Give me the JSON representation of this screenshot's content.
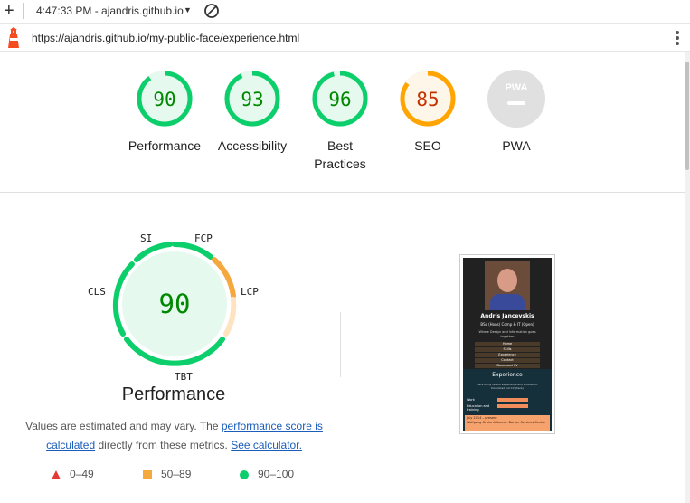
{
  "browser": {
    "time_label": "4:47:33 PM - ajandris.github.io",
    "url": "https://ajandris.github.io/my-public-face/experience.html"
  },
  "summary": [
    {
      "label": "Performance",
      "score": "90",
      "score_value": 90,
      "color": "#0cce6b",
      "text_color": "#008800",
      "fill": "#e6f9ef"
    },
    {
      "label": "Accessibility",
      "score": "93",
      "score_value": 93,
      "color": "#0cce6b",
      "text_color": "#008800",
      "fill": "#e6f9ef"
    },
    {
      "label": "Best Practices",
      "score": "96",
      "score_value": 96,
      "color": "#0cce6b",
      "text_color": "#008800",
      "fill": "#e6f9ef"
    },
    {
      "label": "SEO",
      "score": "85",
      "score_value": 85,
      "color": "#ffa400",
      "text_color": "#c33300",
      "fill": "#fff6ea"
    },
    {
      "label": "PWA",
      "badge": "PWA",
      "color": "#e0e0e0"
    }
  ],
  "performance": {
    "score": "90",
    "title": "Performance",
    "metrics": [
      "SI",
      "FCP",
      "LCP",
      "TBT",
      "CLS"
    ],
    "note_prefix": "Values are estimated and may vary. The ",
    "note_link1": "performance score is calculated",
    "note_middle": " directly from these metrics. ",
    "note_link2": "See calculator."
  },
  "legend": [
    {
      "icon": "triangle-icon",
      "range": "0–49",
      "color": "#e53935"
    },
    {
      "icon": "square-icon",
      "range": "50–89",
      "color": "#f4a83d"
    },
    {
      "icon": "circle-icon",
      "range": "90–100",
      "color": "#0cce6b"
    }
  ],
  "screenshot": {
    "name": "Andris Jancevskis",
    "subtitle": "BSc (Hons) Comp & IT (Open)",
    "tagline": "Where Design and Information goes together",
    "nav": [
      "Home",
      "Skills",
      "Experience",
      "Contact",
      "Download CV"
    ],
    "section_title": "Experience",
    "section_text": "Here is my recent experience and education. Download full CV (here)",
    "filters": [
      "Work",
      "Education and training"
    ],
    "job_dates": "July 2014 – present",
    "job_employer": "Wolfgang Gruhe Alliance - Barton Services Centre"
  }
}
